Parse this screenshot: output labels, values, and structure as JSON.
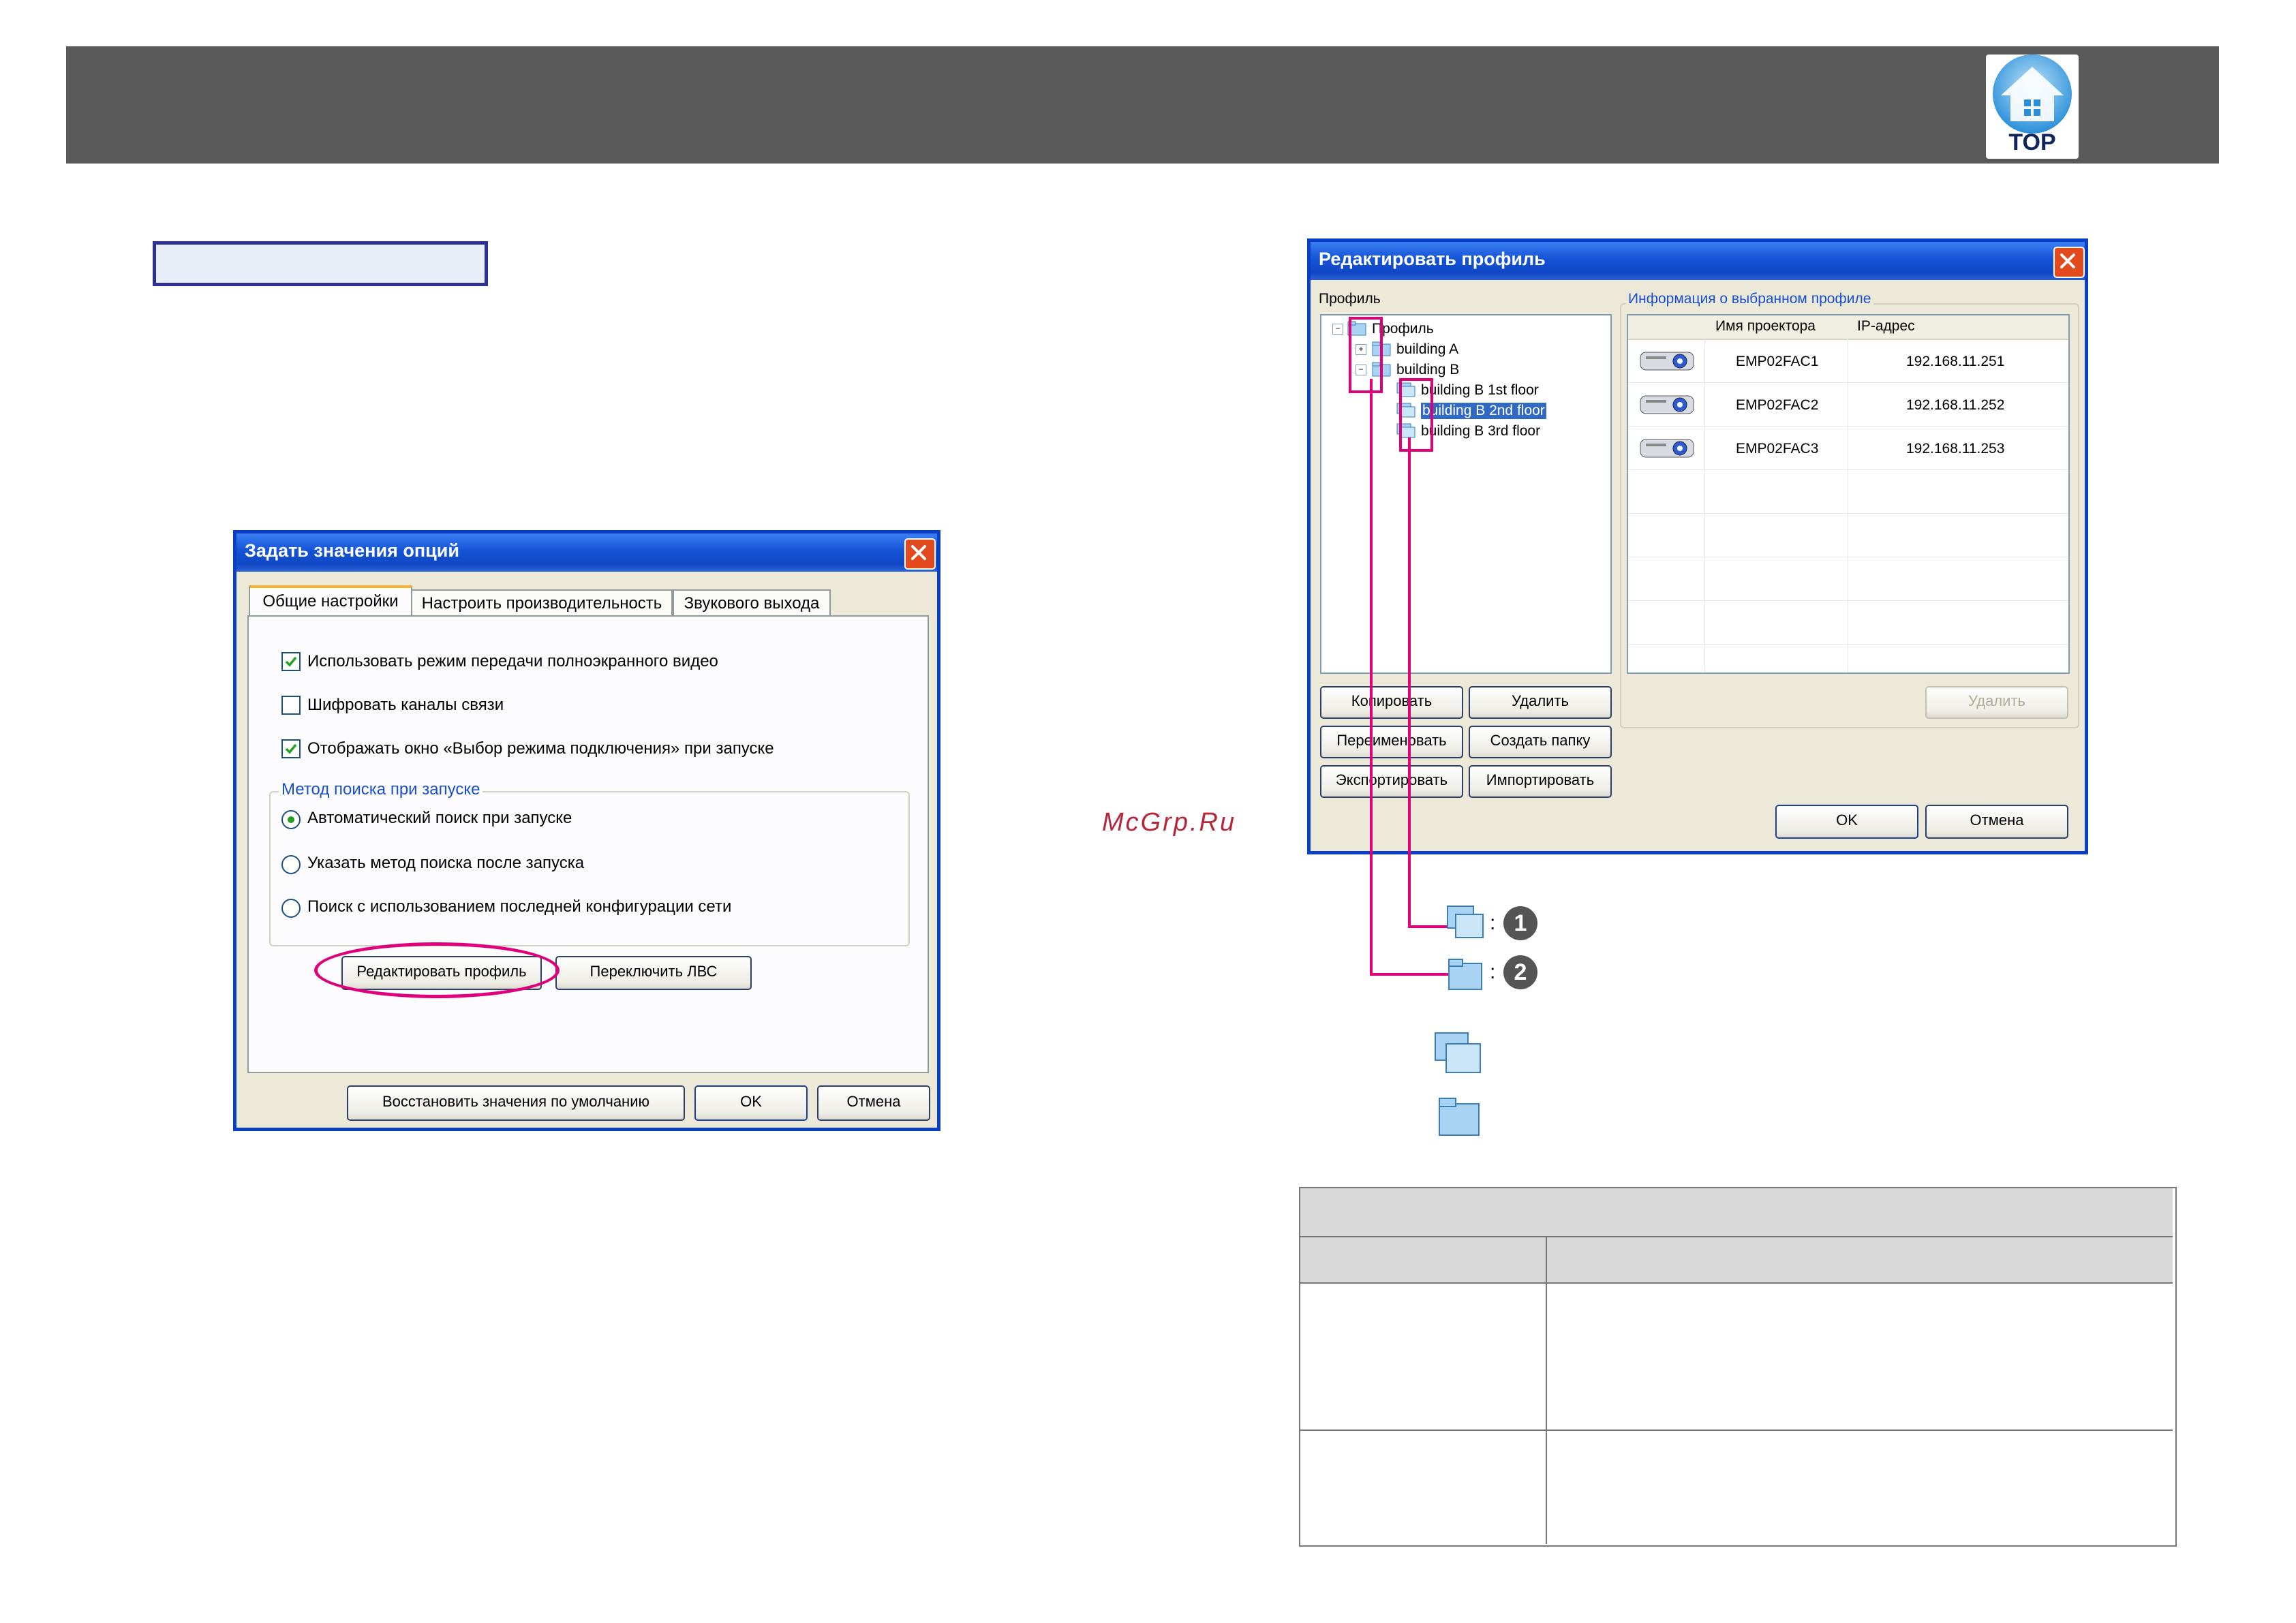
{
  "header": {
    "top_button_label": "TOP"
  },
  "watermark": "McGrp.Ru",
  "options_dialog": {
    "title": "Задать значения опций",
    "tabs": [
      "Общие настройки",
      "Настроить производительность",
      "Звукового выхода"
    ],
    "checkboxes": [
      {
        "label": "Использовать режим передачи полноэкранного видео",
        "checked": true
      },
      {
        "label": "Шифровать каналы связи",
        "checked": false
      },
      {
        "label": "Отображать окно «Выбор режима подключения» при запуске",
        "checked": true
      }
    ],
    "search_group_title": "Метод поиска при запуске",
    "radios": [
      {
        "label": "Автоматический поиск при запуске",
        "selected": true
      },
      {
        "label": "Указать метод поиска после запуска",
        "selected": false
      },
      {
        "label": "Поиск с использованием последней конфигурации сети",
        "selected": false
      }
    ],
    "edit_profile_button": "Редактировать профиль",
    "switch_lan_button": "Переключить ЛВС",
    "restore_defaults_button": "Восстановить значения по умолчанию",
    "ok_button": "OK",
    "cancel_button": "Отмена"
  },
  "profile_dialog": {
    "title": "Редактировать профиль",
    "profile_label": "Профиль",
    "tree": [
      {
        "label": "Профиль",
        "level": 0,
        "expander": "−"
      },
      {
        "label": "building A",
        "level": 1,
        "expander": "+"
      },
      {
        "label": "building B",
        "level": 1,
        "expander": "−"
      },
      {
        "label": "building B 1st floor",
        "level": 2
      },
      {
        "label": "building B 2nd floor",
        "level": 2,
        "selected": true
      },
      {
        "label": "building B 3rd floor",
        "level": 2
      }
    ],
    "info_group_title": "Информация о выбранном профиле",
    "columns": [
      "Имя проектора",
      "IP-адрес"
    ],
    "rows": [
      {
        "name": "EMP02FAC1",
        "ip": "192.168.11.251"
      },
      {
        "name": "EMP02FAC2",
        "ip": "192.168.11.252"
      },
      {
        "name": "EMP02FAC3",
        "ip": "192.168.11.253"
      }
    ],
    "copy_button": "Копировать",
    "delete_button": "Удалить",
    "rename_button": "Переименовать",
    "new_folder_button": "Создать папку",
    "export_button": "Экспортировать",
    "import_button": "Импортировать",
    "delete_disabled_button": "Удалить",
    "ok_button": "OK",
    "cancel_button": "Отмена"
  },
  "legend": [
    {
      "colon": ":",
      "number": "1"
    },
    {
      "colon": ":",
      "number": "2"
    }
  ],
  "colors": {
    "header_bar": "#595959",
    "highlight": "#e0007a",
    "xp_title": "#0f47c4",
    "table_head": "#d9d9d9"
  }
}
